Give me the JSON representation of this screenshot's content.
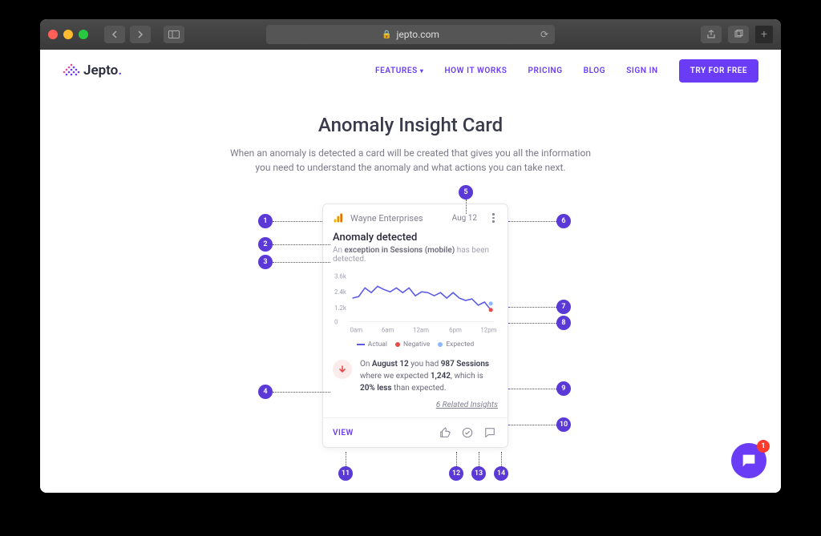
{
  "browser": {
    "url": "jepto.com"
  },
  "site": {
    "brand": "Jepto",
    "nav": {
      "features": "FEATURES",
      "how": "HOW IT WORKS",
      "pricing": "PRICING",
      "blog": "BLOG",
      "signin": "SIGN IN",
      "cta": "TRY FOR FREE"
    }
  },
  "hero": {
    "title": "Anomaly Insight Card",
    "subtitle": "When an anomaly is detected a card will be created that gives you all the information you need to understand the anomaly and what actions you can take next."
  },
  "card": {
    "account": "Wayne Enterprises",
    "date": "Aug 12",
    "title": "Anomaly detected",
    "subtitle_pre": "An ",
    "subtitle_b": "exception in Sessions (mobile)",
    "subtitle_post": " has been detected.",
    "legend": {
      "actual": "Actual",
      "negative": "Negative",
      "expected": "Expected"
    },
    "summary_parts": {
      "p1": "On ",
      "d": "August 12",
      "p2": " you had ",
      "v": "987 Sessions",
      "p3": " where we expected ",
      "e": "1,242",
      "p4": ", which is ",
      "pct": "20% less",
      "p5": " than expected."
    },
    "related": "6 Related Insights",
    "view": "VIEW"
  },
  "chart_data": {
    "type": "line",
    "title": "",
    "xlabel": "",
    "ylabel": "",
    "y_ticks": [
      "3.6k",
      "2.4k",
      "1.2k",
      "0"
    ],
    "x_ticks": [
      "0am",
      "6am",
      "12am",
      "6pm",
      "12pm"
    ],
    "ylim": [
      0,
      3600
    ],
    "series": [
      {
        "name": "Actual",
        "values": [
          1800,
          1900,
          2600,
          2200,
          2700,
          2500,
          2300,
          2600,
          2200,
          2600,
          2000,
          2300,
          2200,
          2000,
          2200,
          1800,
          2200,
          1800,
          1600,
          1700,
          1300,
          1500,
          987
        ]
      },
      {
        "name": "Expected (last point)",
        "values_last": 1242
      },
      {
        "name": "Negative (last point)",
        "values_last": 987
      }
    ]
  },
  "callouts": {
    "1": "1",
    "2": "2",
    "3": "3",
    "4": "4",
    "5": "5",
    "6": "6",
    "7": "7",
    "8": "8",
    "9": "9",
    "10": "10",
    "11": "11",
    "12": "12",
    "13": "13",
    "14": "14"
  },
  "chat": {
    "badge": "1"
  }
}
